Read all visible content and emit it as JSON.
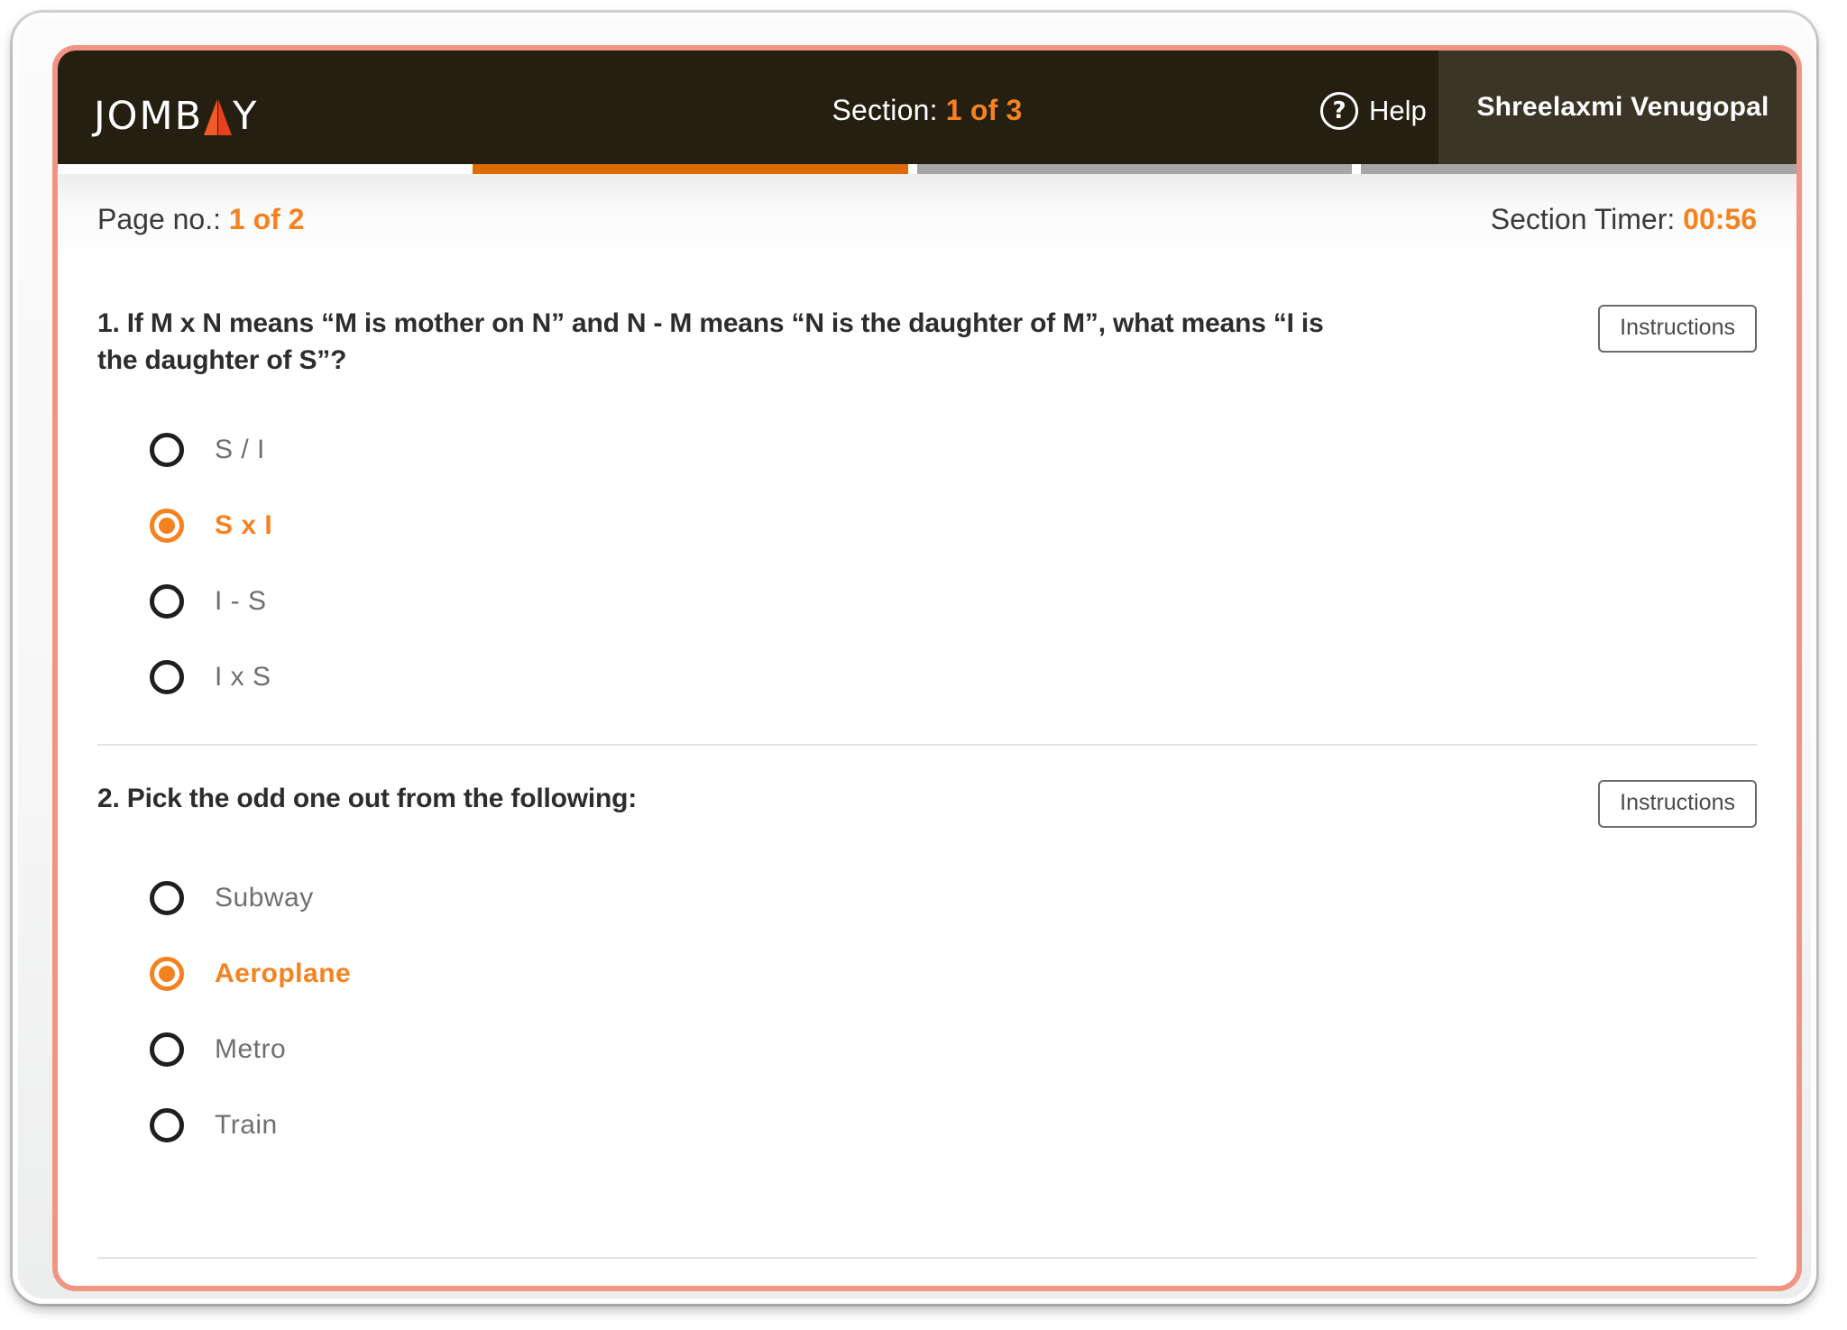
{
  "header": {
    "logo_text_before": "JOMB",
    "logo_text_after": "Y",
    "logo_icon": "triangle-icon",
    "section_label": "Section:",
    "section_value": "1 of 3",
    "help_icon": "question-circle-icon",
    "help_label": "Help",
    "user_name": "Shreelaxmi Venugopal",
    "accent_color": "#f58220",
    "header_bg": "#241f10",
    "user_panel_bg": "#3b3528"
  },
  "progress": {
    "segments": [
      {
        "state": "active",
        "color": "#dd6b00"
      },
      {
        "state": "idle",
        "color": "#a6a6a6"
      },
      {
        "state": "idle",
        "color": "#a6a6a6"
      }
    ]
  },
  "page_bar": {
    "page_label": "Page no.:",
    "page_value": "1 of 2",
    "timer_label": "Section Timer:",
    "timer_value": "00:56"
  },
  "questions": [
    {
      "number": "1.",
      "text": "1. If M x N means “M is mother on N” and N - M means “N is the daughter of M”, what means “I is the daughter of S”?",
      "instructions_label": "Instructions",
      "options": [
        {
          "label": "S / I",
          "selected": false
        },
        {
          "label": "S x I",
          "selected": true
        },
        {
          "label": "I - S",
          "selected": false
        },
        {
          "label": "I x S",
          "selected": false
        }
      ]
    },
    {
      "number": "2.",
      "text": "2. Pick the odd one out from the following:",
      "instructions_label": "Instructions",
      "options": [
        {
          "label": "Subway",
          "selected": false
        },
        {
          "label": "Aeroplane",
          "selected": true
        },
        {
          "label": "Metro",
          "selected": false
        },
        {
          "label": "Train",
          "selected": false
        }
      ]
    }
  ]
}
